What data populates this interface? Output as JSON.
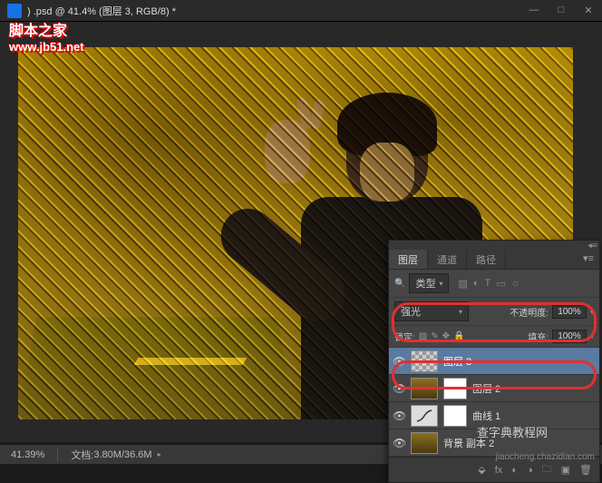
{
  "titlebar": {
    "file_suffix": ") .psd @ 41.4% (图层 3, RGB/8) *"
  },
  "watermark": {
    "site_name": "脚本之家",
    "site_url": "www.jb51.net"
  },
  "statusbar": {
    "zoom": "41.39%",
    "doc_label": "文档:",
    "doc_size": "3.80M/36.6M"
  },
  "panel": {
    "tabs": [
      "图层",
      "通道",
      "路径"
    ],
    "type_label": "类型",
    "blend_mode": "强光",
    "opacity_label": "不透明度:",
    "opacity_value": "100%",
    "lock_label": "锁定:",
    "fill_label": "填充:",
    "fill_value": "100%",
    "layers": [
      {
        "name": "图层 3",
        "selected": true
      },
      {
        "name": "图层 2",
        "selected": false
      },
      {
        "name": "曲线 1",
        "selected": false
      },
      {
        "name": "背景 副本 2",
        "selected": false
      }
    ],
    "footer_fx": "fx"
  },
  "bottom_watermarks": {
    "center": "查字典教程网",
    "url": "jiaocheng.chazidian.com"
  },
  "icons": {
    "minimize": "—",
    "maximize": "□",
    "close": "✕",
    "eye": "👁",
    "chevron": "▾",
    "menu": "▾≡",
    "link": "⬙",
    "fx": "fx",
    "mask": "◐",
    "adjust": "◑",
    "folder": "🗀",
    "new": "▣",
    "trash": "🗑",
    "lock_brush": "✎",
    "lock_pos": "✥",
    "lock_all": "🔒",
    "img": "▧",
    "adj_i": "◐",
    "txt": "T",
    "shape": "▭",
    "fx_i": "☼"
  }
}
